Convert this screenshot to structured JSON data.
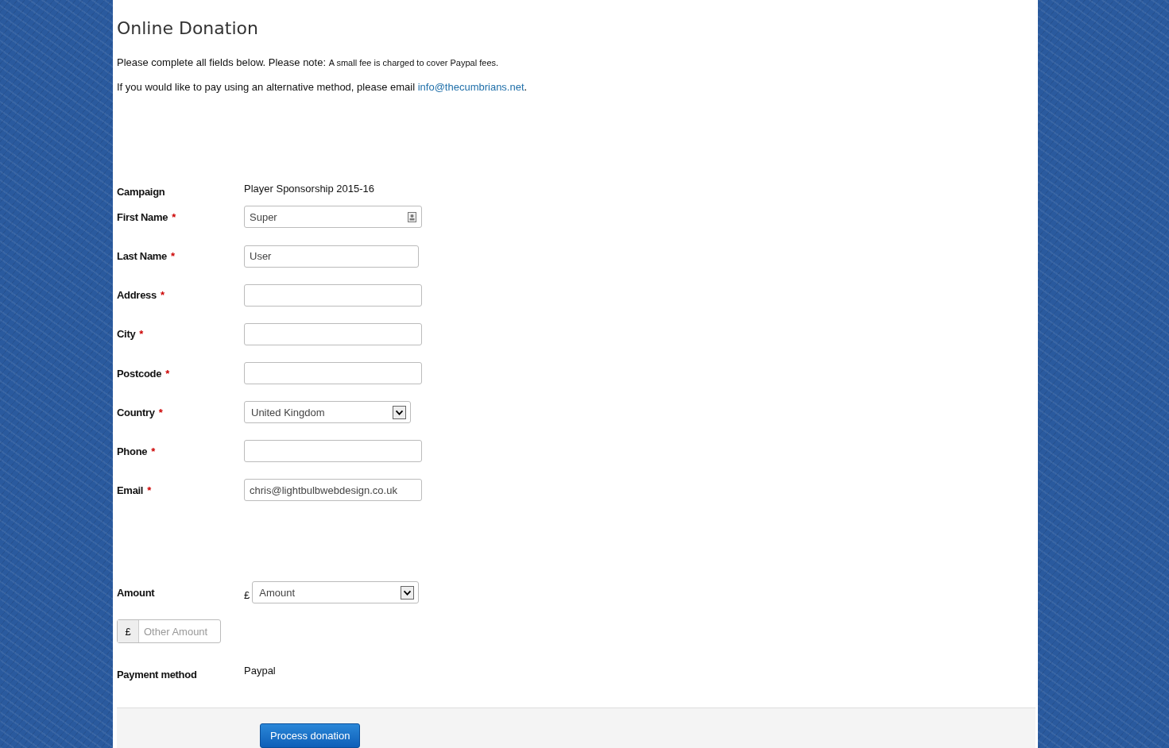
{
  "title": "Online Donation",
  "intro": "Please complete all fields below. Please note: $_{A small fee is charged to cover Paypal fees.}$",
  "alt_text": "If you would like to pay using an alternative method, please email ",
  "alt_link": "info@thecumbrians.net",
  "alt_end": ".",
  "campaign": {
    "label": "Campaign",
    "value": "Player Sponsorship 2015-16"
  },
  "fields": [
    {
      "label": "First Name",
      "required": true,
      "kind": "text",
      "value": "Super",
      "contact_icon": true
    },
    {
      "label": "Last Name",
      "required": true,
      "kind": "text",
      "value": "User",
      "narrow": true
    },
    {
      "label": "Address",
      "required": true,
      "kind": "text"
    },
    {
      "label": "City",
      "required": true,
      "kind": "text"
    },
    {
      "label": "Postcode",
      "required": true,
      "kind": "text"
    },
    {
      "label": "Country",
      "required": true,
      "kind": "select",
      "value": "United Kingdom"
    },
    {
      "label": "Phone",
      "required": true,
      "kind": "text"
    },
    {
      "label": "Email",
      "required": true,
      "kind": "text",
      "value": "chris@lightbulbwebdesign.co.uk"
    }
  ],
  "required_mark": "*",
  "amount": {
    "label": "Amount",
    "currency": "£",
    "placeholder": "Amount"
  },
  "other_amount": {
    "currency": "£",
    "placeholder": "Other Amount"
  },
  "payment": {
    "label": "Payment method",
    "value": "Paypal"
  },
  "submit": "Process donation"
}
